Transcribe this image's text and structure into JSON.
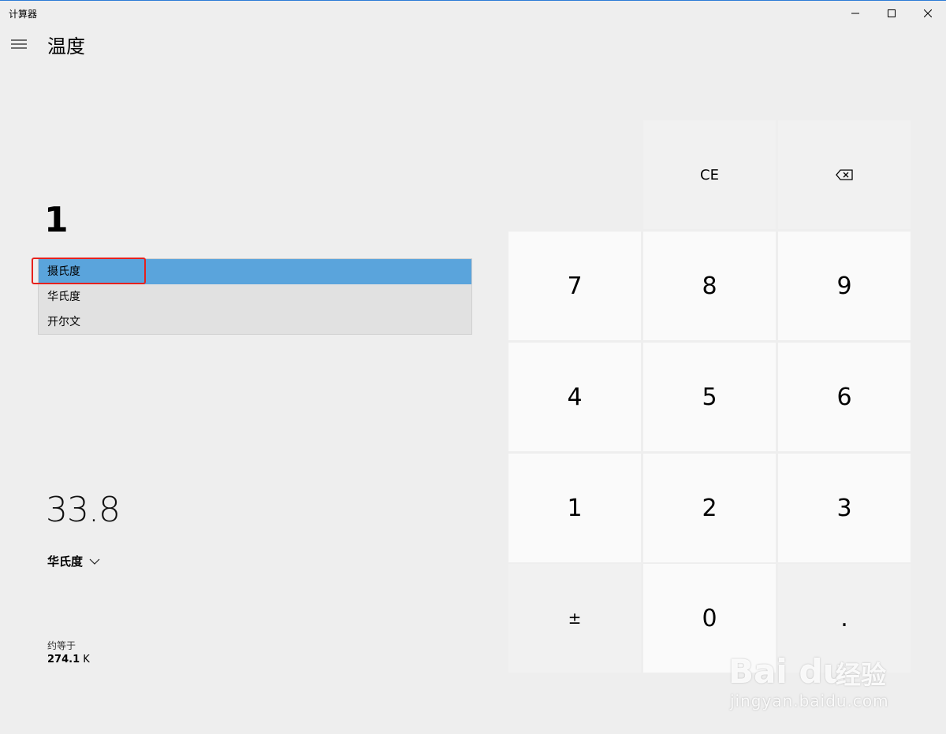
{
  "window": {
    "title": "计算器",
    "controls": [
      "minimize-icon",
      "maximize-icon",
      "close-icon"
    ],
    "accent": "#2b7bd6"
  },
  "header": {
    "menu_icon": "hamburger-icon",
    "mode_title": "温度"
  },
  "converter": {
    "from_value": "1",
    "unit_options": [
      "摄氏度",
      "华氏度",
      "开尔文"
    ],
    "selected_option_index": 0,
    "selection_color": "#5aa4dc",
    "to_value": "33.8",
    "to_unit": "华氏度",
    "approx_label": "约等于",
    "approx_value": "274.1",
    "approx_unit": " K"
  },
  "annotation": {
    "highlight_color": "#e5211d"
  },
  "keypad": {
    "ce": "CE",
    "backspace_icon": "backspace-icon",
    "keys": [
      "7",
      "8",
      "9",
      "4",
      "5",
      "6",
      "1",
      "2",
      "3",
      "±",
      "0",
      "."
    ]
  },
  "watermark": {
    "brand": "Bai du",
    "brand_cn": "经验",
    "url": "jingyan.baidu.com"
  }
}
